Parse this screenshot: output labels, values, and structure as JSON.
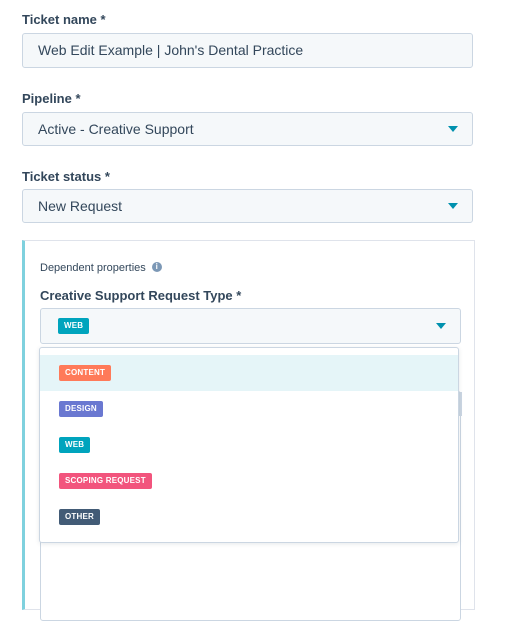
{
  "ticket_name": {
    "label": "Ticket name *",
    "value": "Web Edit Example | John's Dental Practice"
  },
  "pipeline": {
    "label": "Pipeline *",
    "value": "Active - Creative Support"
  },
  "ticket_status": {
    "label": "Ticket status *",
    "value": "New Request"
  },
  "dependent": {
    "title": "Dependent properties",
    "info_icon": "info-icon",
    "field_label": "Creative Support Request Type *",
    "selected": "WEB",
    "selected_color": "#00a4bd"
  },
  "options": [
    {
      "label": "CONTENT",
      "color": "#ff7a59",
      "active": true
    },
    {
      "label": "DESIGN",
      "color": "#6a78d1",
      "active": false
    },
    {
      "label": "WEB",
      "color": "#00a4bd",
      "active": false
    },
    {
      "label": "SCOPING REQUEST",
      "color": "#f2547d",
      "active": false
    },
    {
      "label": "OTHER",
      "color": "#425b76",
      "active": false
    }
  ]
}
